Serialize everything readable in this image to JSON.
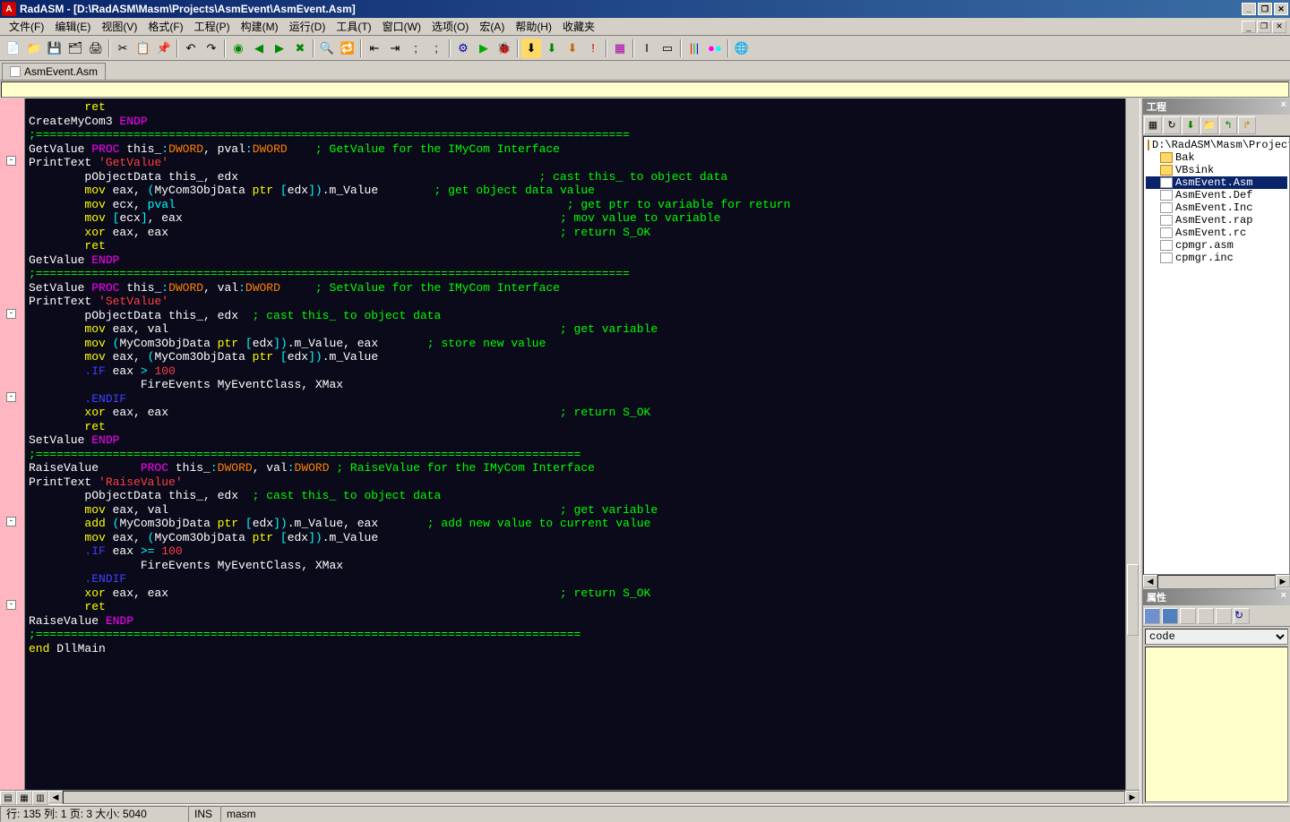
{
  "titlebar": {
    "app": "RadASM",
    "path": "[D:\\RadASM\\Masm\\Projects\\AsmEvent\\AsmEvent.Asm]"
  },
  "menu": [
    "文件(F)",
    "编辑(E)",
    "视图(V)",
    "格式(F)",
    "工程(P)",
    "构建(M)",
    "运行(D)",
    "工具(T)",
    "窗口(W)",
    "选项(O)",
    "宏(A)",
    "帮助(H)",
    "收藏夹"
  ],
  "tab": {
    "label": "AsmEvent.Asm"
  },
  "project_panel": {
    "title": "工程",
    "root": "D:\\RadASM\\Masm\\Projects\\A",
    "folders": [
      "Bak",
      "VBsink"
    ],
    "files": [
      "AsmEvent.Asm",
      "AsmEvent.Def",
      "AsmEvent.Inc",
      "AsmEvent.rap",
      "AsmEvent.rc",
      "cpmgr.asm",
      "cpmgr.inc"
    ],
    "selected": "AsmEvent.Asm"
  },
  "prop_panel": {
    "title": "属性",
    "combo": "code"
  },
  "status": {
    "pos": "行: 135 列: 1 页: 3 大小: 5040",
    "ins": "INS",
    "lang": "masm"
  },
  "code_lines": [
    [
      [
        "        ",
        "w"
      ],
      [
        "ret",
        "y"
      ]
    ],
    [
      [
        "CreateMyCom3 ",
        "w"
      ],
      [
        "ENDP",
        "m"
      ]
    ],
    [
      [
        "",
        "w"
      ]
    ],
    [
      [
        ";=====================================================================================",
        "g"
      ]
    ],
    [
      [
        "GetValue ",
        "w"
      ],
      [
        "PROC ",
        "m"
      ],
      [
        "this_",
        "w"
      ],
      [
        ":",
        "c"
      ],
      [
        "DWORD",
        "o"
      ],
      [
        ", pval",
        "w"
      ],
      [
        ":",
        "c"
      ],
      [
        "DWORD",
        "o"
      ],
      [
        "    ; GetValue for the IMyCom Interface",
        "g"
      ]
    ],
    [
      [
        "PrintText ",
        "w"
      ],
      [
        "'GetValue'",
        "r"
      ]
    ],
    [
      [
        "        pObjectData this_, edx                                           ",
        "w"
      ],
      [
        "; cast this_ to object data",
        "g"
      ]
    ],
    [
      [
        "        ",
        "w"
      ],
      [
        "mov",
        "y"
      ],
      [
        " eax, ",
        "w"
      ],
      [
        "(",
        "c"
      ],
      [
        "MyCom3ObjData ",
        "w"
      ],
      [
        "ptr ",
        "y"
      ],
      [
        "[",
        "c"
      ],
      [
        "edx",
        "w"
      ],
      [
        "])",
        "c"
      ],
      [
        ".m_Value        ",
        "w"
      ],
      [
        "; get object data value",
        "g"
      ]
    ],
    [
      [
        "        ",
        "w"
      ],
      [
        "mov",
        "y"
      ],
      [
        " ecx, ",
        "w"
      ],
      [
        "pval",
        "c"
      ],
      [
        "                                                        ",
        "w"
      ],
      [
        "; get ptr to variable for return",
        "g"
      ]
    ],
    [
      [
        "        ",
        "w"
      ],
      [
        "mov",
        "y"
      ],
      [
        " ",
        "w"
      ],
      [
        "[",
        "c"
      ],
      [
        "ecx",
        "w"
      ],
      [
        "]",
        "c"
      ],
      [
        ", eax                                                      ",
        "w"
      ],
      [
        "; mov value to variable",
        "g"
      ]
    ],
    [
      [
        "        ",
        "w"
      ],
      [
        "xor",
        "y"
      ],
      [
        " eax, eax                                                        ",
        "w"
      ],
      [
        "; return S_OK",
        "g"
      ]
    ],
    [
      [
        "        ",
        "w"
      ],
      [
        "ret",
        "y"
      ]
    ],
    [
      [
        "GetValue ",
        "w"
      ],
      [
        "ENDP",
        "m"
      ]
    ],
    [
      [
        "",
        "w"
      ]
    ],
    [
      [
        ";=====================================================================================",
        "g"
      ]
    ],
    [
      [
        "SetValue ",
        "w"
      ],
      [
        "PROC ",
        "m"
      ],
      [
        "this_",
        "w"
      ],
      [
        ":",
        "c"
      ],
      [
        "DWORD",
        "o"
      ],
      [
        ", val",
        "w"
      ],
      [
        ":",
        "c"
      ],
      [
        "DWORD",
        "o"
      ],
      [
        "     ; SetValue for the IMyCom Interface",
        "g"
      ]
    ],
    [
      [
        "PrintText ",
        "w"
      ],
      [
        "'SetValue'",
        "r"
      ]
    ],
    [
      [
        "        pObjectData this_, edx  ",
        "w"
      ],
      [
        "; cast this_ to object data",
        "g"
      ]
    ],
    [
      [
        "        ",
        "w"
      ],
      [
        "mov",
        "y"
      ],
      [
        " eax, val                                                        ",
        "w"
      ],
      [
        "; get variable",
        "g"
      ]
    ],
    [
      [
        "        ",
        "w"
      ],
      [
        "mov",
        "y"
      ],
      [
        " ",
        "w"
      ],
      [
        "(",
        "c"
      ],
      [
        "MyCom3ObjData ",
        "w"
      ],
      [
        "ptr ",
        "y"
      ],
      [
        "[",
        "c"
      ],
      [
        "edx",
        "w"
      ],
      [
        "])",
        "c"
      ],
      [
        ".m_Value, eax       ",
        "w"
      ],
      [
        "; store new value",
        "g"
      ]
    ],
    [
      [
        "        ",
        "w"
      ],
      [
        "mov",
        "y"
      ],
      [
        " eax, ",
        "w"
      ],
      [
        "(",
        "c"
      ],
      [
        "MyCom3ObjData ",
        "w"
      ],
      [
        "ptr ",
        "y"
      ],
      [
        "[",
        "c"
      ],
      [
        "edx",
        "w"
      ],
      [
        "])",
        "c"
      ],
      [
        ".m_Value",
        "w"
      ]
    ],
    [
      [
        "        ",
        "w"
      ],
      [
        ".IF",
        "db"
      ],
      [
        " eax ",
        "w"
      ],
      [
        "> ",
        "c"
      ],
      [
        "100",
        "r"
      ]
    ],
    [
      [
        "                FireEvents MyEventClass, XMax",
        "w"
      ]
    ],
    [
      [
        "        ",
        "w"
      ],
      [
        ".ENDIF",
        "db"
      ]
    ],
    [
      [
        "        ",
        "w"
      ],
      [
        "xor",
        "y"
      ],
      [
        " eax, eax                                                        ",
        "w"
      ],
      [
        "; return S_OK",
        "g"
      ]
    ],
    [
      [
        "        ",
        "w"
      ],
      [
        "ret",
        "y"
      ]
    ],
    [
      [
        "SetValue ",
        "w"
      ],
      [
        "ENDP",
        "m"
      ]
    ],
    [
      [
        "",
        "w"
      ]
    ],
    [
      [
        ";==============================================================================",
        "g"
      ]
    ],
    [
      [
        "",
        "w"
      ]
    ],
    [
      [
        "RaiseValue      ",
        "w"
      ],
      [
        "PROC ",
        "m"
      ],
      [
        "this_",
        "w"
      ],
      [
        ":",
        "c"
      ],
      [
        "DWORD",
        "o"
      ],
      [
        ", val",
        "w"
      ],
      [
        ":",
        "c"
      ],
      [
        "DWORD",
        "o"
      ],
      [
        " ; RaiseValue for the IMyCom Interface",
        "g"
      ]
    ],
    [
      [
        "PrintText ",
        "w"
      ],
      [
        "'RaiseValue'",
        "r"
      ]
    ],
    [
      [
        "        pObjectData this_, edx  ",
        "w"
      ],
      [
        "; cast this_ to object data",
        "g"
      ]
    ],
    [
      [
        "        ",
        "w"
      ],
      [
        "mov",
        "y"
      ],
      [
        " eax, val                                                        ",
        "w"
      ],
      [
        "; get variable",
        "g"
      ]
    ],
    [
      [
        "        ",
        "w"
      ],
      [
        "add",
        "y"
      ],
      [
        " ",
        "w"
      ],
      [
        "(",
        "c"
      ],
      [
        "MyCom3ObjData ",
        "w"
      ],
      [
        "ptr ",
        "y"
      ],
      [
        "[",
        "c"
      ],
      [
        "edx",
        "w"
      ],
      [
        "])",
        "c"
      ],
      [
        ".m_Value, eax       ",
        "w"
      ],
      [
        "; add new value to current value",
        "g"
      ]
    ],
    [
      [
        "        ",
        "w"
      ],
      [
        "mov",
        "y"
      ],
      [
        " eax, ",
        "w"
      ],
      [
        "(",
        "c"
      ],
      [
        "MyCom3ObjData ",
        "w"
      ],
      [
        "ptr ",
        "y"
      ],
      [
        "[",
        "c"
      ],
      [
        "edx",
        "w"
      ],
      [
        "])",
        "c"
      ],
      [
        ".m_Value",
        "w"
      ]
    ],
    [
      [
        "        ",
        "w"
      ],
      [
        ".IF",
        "db"
      ],
      [
        " eax ",
        "w"
      ],
      [
        ">= ",
        "c"
      ],
      [
        "100",
        "r"
      ]
    ],
    [
      [
        "                FireEvents MyEventClass, XMax",
        "w"
      ]
    ],
    [
      [
        "        ",
        "w"
      ],
      [
        ".ENDIF",
        "db"
      ]
    ],
    [
      [
        "        ",
        "w"
      ],
      [
        "xor",
        "y"
      ],
      [
        " eax, eax                                                        ",
        "w"
      ],
      [
        "; return S_OK",
        "g"
      ]
    ],
    [
      [
        "        ",
        "w"
      ],
      [
        "ret",
        "y"
      ]
    ],
    [
      [
        "RaiseValue ",
        "w"
      ],
      [
        "ENDP",
        "m"
      ]
    ],
    [
      [
        "",
        "w"
      ]
    ],
    [
      [
        ";==============================================================================",
        "g"
      ]
    ],
    [
      [
        "end",
        "y"
      ],
      [
        " DllMain",
        "w"
      ]
    ]
  ],
  "folds": [
    {
      "line": 4,
      "sym": "-"
    },
    {
      "line": 15,
      "sym": "-"
    },
    {
      "line": 21,
      "sym": "-"
    },
    {
      "line": 30,
      "sym": "-"
    },
    {
      "line": 36,
      "sym": "-"
    }
  ]
}
